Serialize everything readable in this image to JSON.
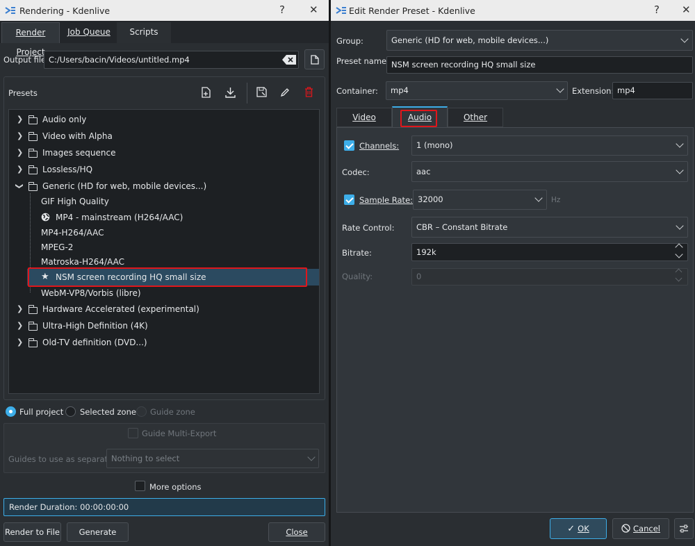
{
  "left_window": {
    "title": "Rendering - Kdenlive",
    "tabs": [
      "Render Project",
      "Job Queue",
      "Scripts"
    ],
    "output_file_label": "Output file",
    "output_file_value": "C:/Users/bacin/Videos/untitled.mp4",
    "presets_label": "Presets",
    "tree": {
      "folders_top": [
        "Audio only",
        "Video with Alpha",
        "Images sequence",
        "Lossless/HQ"
      ],
      "open_folder": "Generic (HD for web, mobile devices...)",
      "items": [
        "GIF High Quality",
        "MP4 - mainstream (H264/AAC)",
        "MP4-H264/AAC",
        "MPEG-2",
        "Matroska-H264/AAC",
        "NSM screen recording HQ small size",
        "WebM-VP8/Vorbis (libre)"
      ],
      "selected_item": "NSM screen recording HQ small size",
      "folders_bottom": [
        "Hardware Accelerated (experimental)",
        "Ultra-High Definition (4K)",
        "Old-TV definition (DVD...)"
      ]
    },
    "range_options": [
      "Full project",
      "Selected zone",
      "Guide zone"
    ],
    "guide_multi_export": "Guide Multi-Export",
    "guides_separator_label": "Guides to use as separator:",
    "guides_separator_value": "Nothing to select",
    "more_options": "More options",
    "render_duration": "Render Duration: 00:00:00:00",
    "buttons": {
      "render": "Render to File",
      "script": "Generate Script",
      "close": "Close"
    }
  },
  "right_window": {
    "title": "Edit Render Preset - Kdenlive",
    "group_label": "Group:",
    "group_value": "Generic (HD for web, mobile devices...)",
    "preset_name_label": "Preset name:",
    "preset_name_value": "NSM screen recording HQ small size",
    "container_label": "Container:",
    "container_value": "mp4",
    "extension_label": "Extension:",
    "extension_value": "mp4",
    "tabs": [
      "Video",
      "Audio",
      "Other"
    ],
    "active_tab": "Audio",
    "audio": {
      "channels_label": "Channels:",
      "channels_value": "1 (mono)",
      "codec_label": "Codec:",
      "codec_value": "aac",
      "sample_rate_label": "Sample Rate:",
      "sample_rate_value": "32000",
      "sample_rate_unit": "Hz",
      "rate_control_label": "Rate Control:",
      "rate_control_value": "CBR – Constant Bitrate",
      "bitrate_label": "Bitrate:",
      "bitrate_value": "192k",
      "quality_label": "Quality:",
      "quality_value": "0"
    },
    "buttons": {
      "ok": "OK",
      "cancel": "Cancel"
    }
  },
  "colors": {
    "accent": "#3daee9",
    "highlight": "#e0161b",
    "selection": "#2b4a60"
  }
}
